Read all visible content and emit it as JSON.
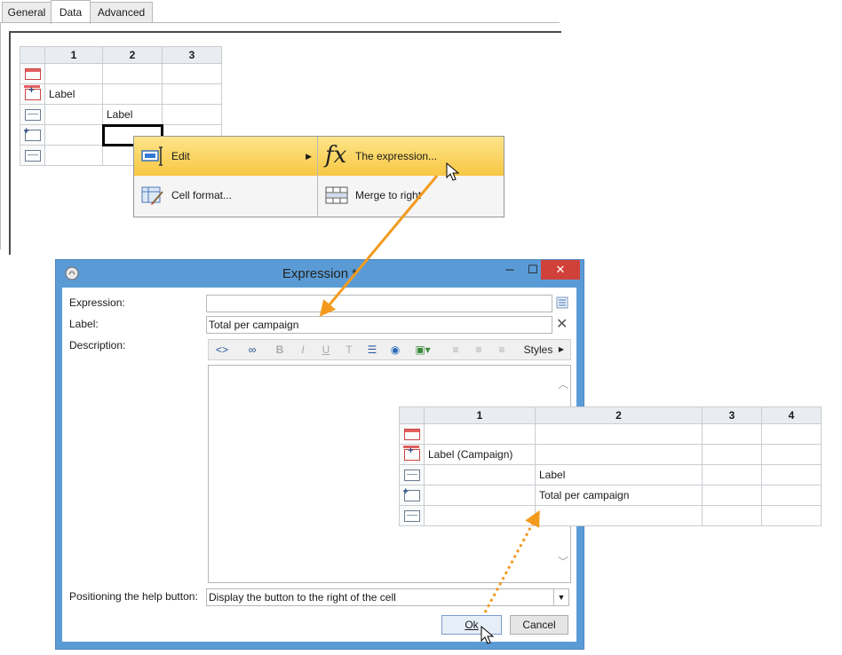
{
  "tabs": [
    "General",
    "Data",
    "Advanced"
  ],
  "top_grid": {
    "columns": [
      "1",
      "2",
      "3"
    ],
    "rows": [
      [
        "",
        "",
        ""
      ],
      [
        "Label",
        "",
        ""
      ],
      [
        "",
        "Label",
        ""
      ],
      [
        "",
        "",
        ""
      ],
      [
        "",
        "",
        ""
      ]
    ]
  },
  "context_menu": {
    "edit_label": "Edit",
    "cell_format_label": "Cell format...",
    "expression_label": "The expression...",
    "merge_label": "Merge to right"
  },
  "dialog": {
    "title": "Expression *",
    "expression_label": "Expression:",
    "expression_value": "",
    "label_label": "Label:",
    "label_value": "Total per campaign",
    "description_label": "Description:",
    "styles_label": "Styles",
    "help_position_label": "Positioning the help button:",
    "help_position_value": "Display the button to the right of the cell",
    "ok_label": "Ok",
    "cancel_label": "Cancel"
  },
  "result_grid": {
    "columns": [
      "1",
      "2",
      "3",
      "4"
    ],
    "rows": [
      [
        "",
        "",
        "",
        ""
      ],
      [
        "Label (Campaign)",
        "",
        "",
        ""
      ],
      [
        "",
        "Label",
        "",
        ""
      ],
      [
        "",
        "Total per campaign",
        "",
        ""
      ],
      [
        "",
        "",
        "",
        ""
      ]
    ]
  },
  "colors": {
    "menu_highlight": "#f8c743",
    "dialog_frame": "#5b9bd5",
    "close_button": "#d0413a",
    "arrow": "#f39a1e"
  }
}
